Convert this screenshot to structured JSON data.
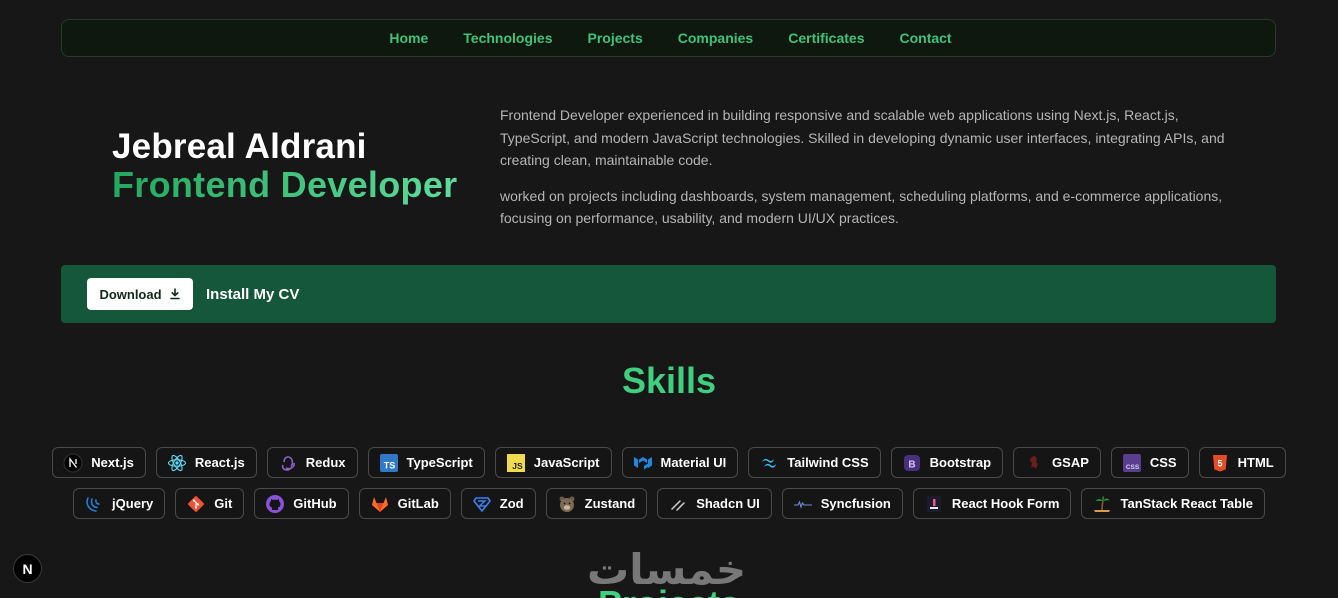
{
  "nav": {
    "items": [
      "Home",
      "Technologies",
      "Projects",
      "Companies",
      "Certificates",
      "Contact"
    ]
  },
  "hero": {
    "name": "Jebreal Aldrani",
    "role": "Frontend Developer",
    "about_1": "Frontend Developer experienced in building responsive and scalable web applications using Next.js, React.js, TypeScript, and modern JavaScript technologies. Skilled in developing dynamic user interfaces, integrating APIs, and creating clean, maintainable code.",
    "about_2": "worked on projects including dashboards, system management, scheduling platforms, and e-commerce applications, focusing on performance, usability, and modern UI/UX practices."
  },
  "cv": {
    "button_label": "Download",
    "label": "Install My CV"
  },
  "skills": {
    "title": "Skills",
    "row1": [
      "Next.js",
      "React.js",
      "Redux",
      "TypeScript",
      "JavaScript",
      "Material UI",
      "Tailwind CSS",
      "Bootstrap",
      "GSAP",
      "CSS",
      "HTML"
    ],
    "row2": [
      "jQuery",
      "Git",
      "GitHub",
      "GitLab",
      "Zod",
      "Zustand",
      "Shadcn UI",
      "Syncfusion",
      "React Hook Form",
      "TanStack React Table"
    ]
  },
  "footer": {
    "watermark": "خمسات",
    "next_title": "Projects",
    "next_badge": "N"
  },
  "colors": {
    "accent": "#3fc27a",
    "cv_bar": "#14573a",
    "background": "#171717"
  }
}
